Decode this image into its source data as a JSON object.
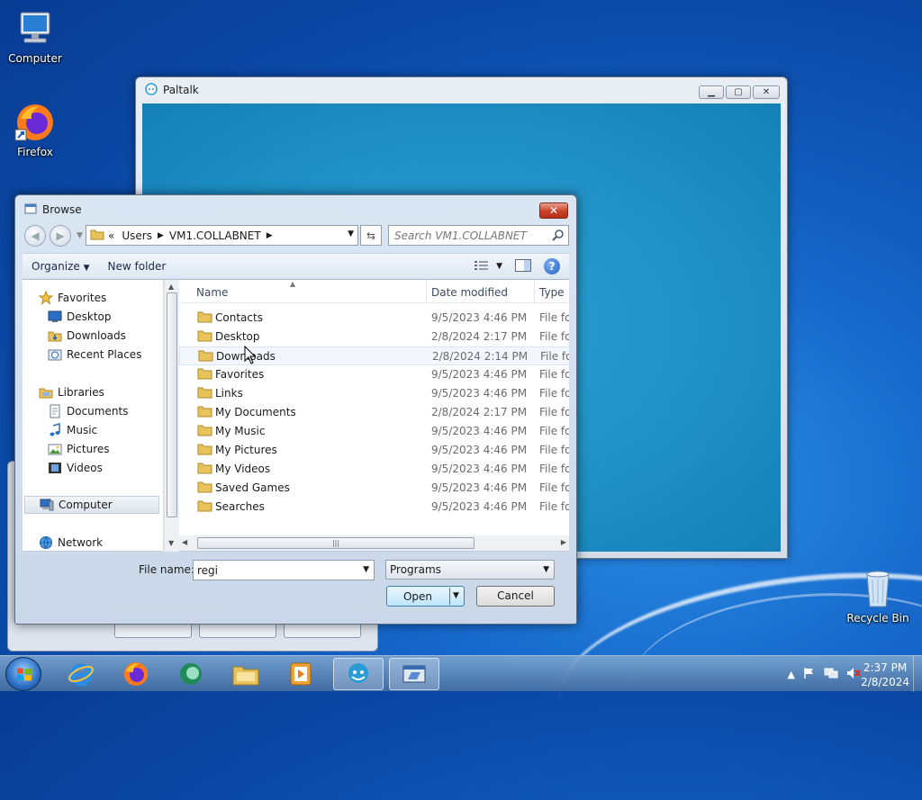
{
  "desktop": {
    "icons": [
      {
        "label": "Computer"
      },
      {
        "label": "Firefox"
      },
      {
        "label": "Recycle Bin"
      }
    ]
  },
  "paltalk": {
    "title": "Paltalk"
  },
  "browse": {
    "title": "Browse",
    "address": {
      "overflow": "«",
      "segments": [
        "Users",
        "VM1.COLLABNET"
      ]
    },
    "search_placeholder": "Search VM1.COLLABNET",
    "toolbar": {
      "organize": "Organize",
      "new_folder": "New folder"
    },
    "nav": {
      "favorites": "Favorites",
      "favorites_items": [
        "Desktop",
        "Downloads",
        "Recent Places"
      ],
      "libraries": "Libraries",
      "libraries_items": [
        "Documents",
        "Music",
        "Pictures",
        "Videos"
      ],
      "computer": "Computer",
      "network": "Network"
    },
    "columns": {
      "name": "Name",
      "date": "Date modified",
      "type": "Type"
    },
    "files": [
      {
        "name": "Contacts",
        "date": "9/5/2023 4:46 PM",
        "type": "File folder"
      },
      {
        "name": "Desktop",
        "date": "2/8/2024 2:17 PM",
        "type": "File folder"
      },
      {
        "name": "Downloads",
        "date": "2/8/2024 2:14 PM",
        "type": "File folder"
      },
      {
        "name": "Favorites",
        "date": "9/5/2023 4:46 PM",
        "type": "File folder"
      },
      {
        "name": "Links",
        "date": "9/5/2023 4:46 PM",
        "type": "File folder"
      },
      {
        "name": "My Documents",
        "date": "2/8/2024 2:17 PM",
        "type": "File folder"
      },
      {
        "name": "My Music",
        "date": "9/5/2023 4:46 PM",
        "type": "File folder"
      },
      {
        "name": "My Pictures",
        "date": "9/5/2023 4:46 PM",
        "type": "File folder"
      },
      {
        "name": "My Videos",
        "date": "9/5/2023 4:46 PM",
        "type": "File folder"
      },
      {
        "name": "Saved Games",
        "date": "9/5/2023 4:46 PM",
        "type": "File folder"
      },
      {
        "name": "Searches",
        "date": "9/5/2023 4:46 PM",
        "type": "File folder"
      }
    ],
    "hovered_file": "Downloads",
    "file_name_label": "File name:",
    "file_name_value": "regi",
    "file_type": "Programs",
    "open_label": "Open",
    "cancel_label": "Cancel"
  },
  "taskbar": {
    "time": "2:37 PM",
    "date": "2/8/2024"
  },
  "colors": {
    "folder": "#e8c25a",
    "accent": "#3c7fb1"
  }
}
